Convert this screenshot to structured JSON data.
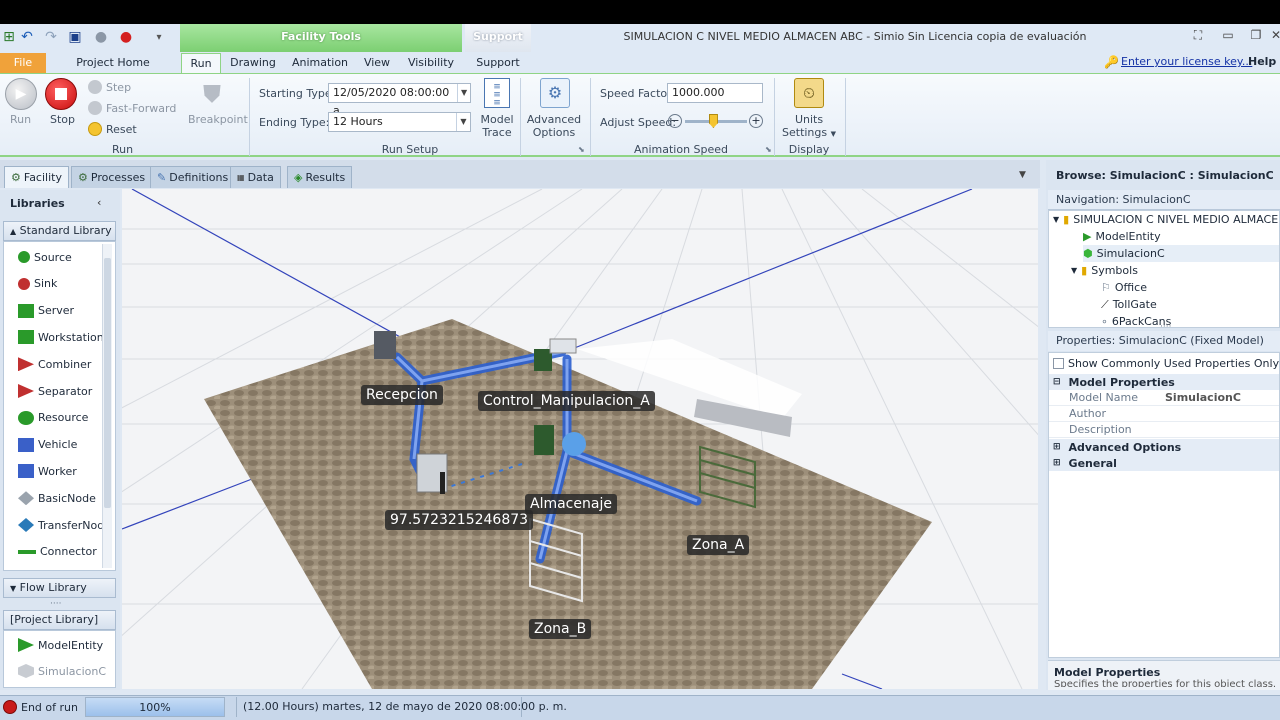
{
  "window": {
    "title": "SIMULACION C NIVEL MEDIO ALMACEN ABC - Simio Sin Licencia copia de evaluación"
  },
  "context_tabs": {
    "facility_tools": "Facility Tools",
    "support": "Support"
  },
  "ribbon_tabs": [
    "File",
    "Project Home",
    "Run",
    "Drawing",
    "Animation",
    "View",
    "Visibility",
    "Support"
  ],
  "header_links": {
    "license": "Enter your license key...",
    "help": "Help"
  },
  "run_group": {
    "run": "Run",
    "stop": "Stop",
    "step": "Step",
    "fast_forward": "Fast-Forward",
    "reset": "Reset",
    "label": "Run",
    "breakpoint": "Breakpoint"
  },
  "run_setup": {
    "starting_type_label": "Starting Type:",
    "starting_type_value": "12/05/2020 08:00:00 a...",
    "ending_type_label": "Ending Type:",
    "ending_type_value": "12 Hours",
    "model_trace": "Model Trace",
    "advanced_options": "Advanced Options",
    "label": "Run Setup"
  },
  "animation_speed": {
    "speed_factor_label": "Speed Factor:",
    "speed_factor_value": "1000.000",
    "adjust_speed_label": "Adjust Speed:",
    "label": "Animation Speed",
    "slider_level": 0.45
  },
  "display": {
    "units_settings": "Units Settings",
    "label": "Display"
  },
  "view_tabs": [
    "Facility",
    "Processes",
    "Definitions",
    "Data",
    "Results"
  ],
  "libraries": {
    "title": "Libraries",
    "standard_library": "Standard Library",
    "items": [
      "Source",
      "Sink",
      "Server",
      "Workstation",
      "Combiner",
      "Separator",
      "Resource",
      "Vehicle",
      "Worker",
      "BasicNode",
      "TransferNod",
      "Connector"
    ],
    "flow_library": "Flow Library",
    "project_library": "[Project Library]",
    "project_items": [
      "ModelEntity",
      "SimulacionC"
    ]
  },
  "facility": {
    "labels": {
      "recepcion": "Recepcion",
      "control": "Control_Manipulacion_A",
      "almacenaje": "Almacenaje",
      "zona_a": "Zona_A",
      "zona_b": "Zona_B",
      "value": "97.5723215246873"
    }
  },
  "browse": {
    "title": "Browse: SimulacionC : SimulacionC",
    "navigation": "Navigation: SimulacionC"
  },
  "nav_tree": [
    "SIMULACION C NIVEL MEDIO ALMACEN...",
    "ModelEntity",
    "SimulacionC",
    "Symbols",
    "Office",
    "TollGate",
    "6PackCans"
  ],
  "properties": {
    "header": "Properties: SimulacionC (Fixed Model)",
    "show_common": "Show Commonly Used Properties Only",
    "model_properties": "Model Properties",
    "model_name_label": "Model Name",
    "model_name_value": "SimulacionC",
    "author_label": "Author",
    "description_label": "Description",
    "advanced_options": "Advanced Options",
    "general": "General",
    "desc_title": "Model Properties",
    "desc_text": "Specifies the properties for this object class."
  },
  "status": {
    "state": "End of run",
    "progress": "100%",
    "progress_fraction": 1.0,
    "time": "(12.00 Hours) martes, 12 de mayo de 2020 08:00:00 p. m."
  }
}
